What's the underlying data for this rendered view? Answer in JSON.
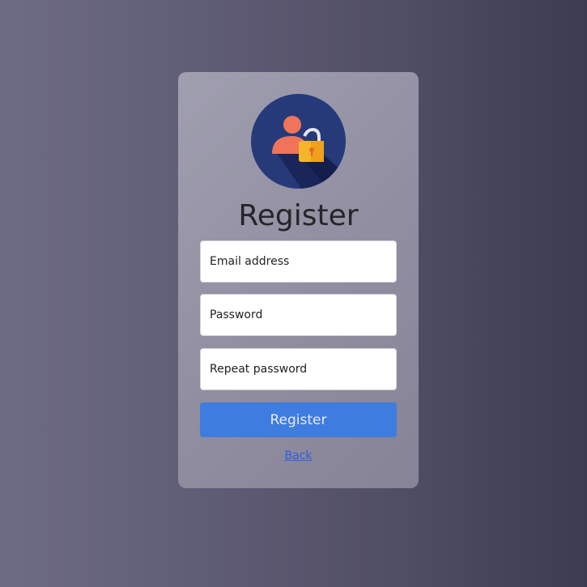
{
  "form": {
    "title": "Register",
    "email_placeholder": "Email address",
    "password_placeholder": "Password",
    "repeat_password_placeholder": "Repeat password",
    "submit_label": "Register",
    "back_link": "Back"
  },
  "icons": {
    "avatar": "user-lock-icon"
  },
  "colors": {
    "button": "#3e7ce0",
    "link": "#2f5ce6",
    "avatar_bg": "#263a7a"
  }
}
